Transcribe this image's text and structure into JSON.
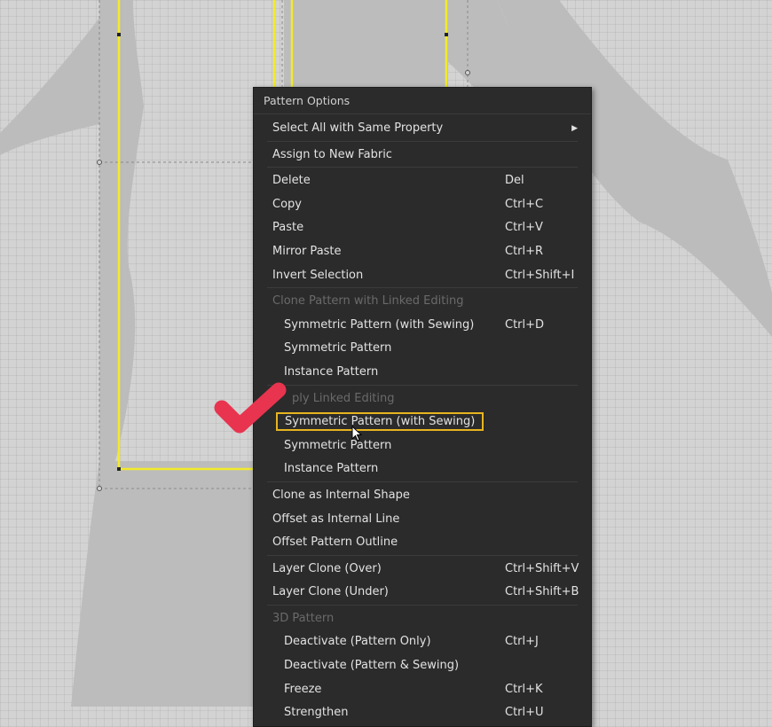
{
  "menu": {
    "title": "Pattern Options",
    "items": [
      {
        "label": "Select All with Same Property"
      },
      {
        "label": "Assign to New Fabric"
      },
      {
        "label": "Delete",
        "shortcut": "Del"
      },
      {
        "label": "Copy",
        "shortcut": "Ctrl+C"
      },
      {
        "label": "Paste",
        "shortcut": "Ctrl+V"
      },
      {
        "label": "Mirror Paste",
        "shortcut": "Ctrl+R"
      },
      {
        "label": "Invert Selection",
        "shortcut": "Ctrl+Shift+I"
      },
      {
        "label": "Clone Pattern with Linked Editing"
      },
      {
        "label": "Symmetric Pattern (with Sewing)",
        "shortcut": "Ctrl+D"
      },
      {
        "label": "Symmetric Pattern"
      },
      {
        "label": "Instance Pattern"
      },
      {
        "label": "ply Linked Editing"
      },
      {
        "label": "Symmetric Pattern (with Sewing)"
      },
      {
        "label": "Symmetric Pattern"
      },
      {
        "label": "Instance Pattern"
      },
      {
        "label": "Clone as Internal Shape"
      },
      {
        "label": "Offset as Internal Line"
      },
      {
        "label": "Offset Pattern Outline"
      },
      {
        "label": "Layer Clone (Over)",
        "shortcut": "Ctrl+Shift+V"
      },
      {
        "label": "Layer Clone (Under)",
        "shortcut": "Ctrl+Shift+B"
      },
      {
        "label": "3D Pattern"
      },
      {
        "label": "Deactivate (Pattern Only)",
        "shortcut": "Ctrl+J"
      },
      {
        "label": "Deactivate (Pattern & Sewing)"
      },
      {
        "label": "Freeze",
        "shortcut": "Ctrl+K"
      },
      {
        "label": "Strengthen",
        "shortcut": "Ctrl+U"
      }
    ]
  },
  "colors": {
    "menu_bg": "#2b2b2b",
    "highlight_border": "#e7b41f",
    "pattern_outline": "#f2ea2a",
    "checkmark": "#e8344f"
  },
  "icons": [
    "submenu-arrow-icon",
    "checkmark-icon",
    "mouse-cursor-icon"
  ]
}
